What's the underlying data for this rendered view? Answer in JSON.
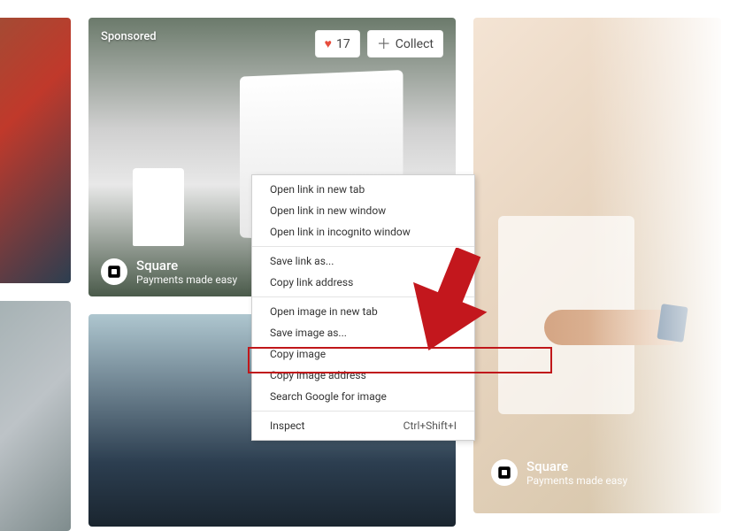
{
  "cards": {
    "sponsored_label": "Sponsored",
    "like_count": "17",
    "collect_label": "Collect",
    "brand_name": "Square",
    "brand_tagline": "Payments made easy"
  },
  "context_menu": {
    "items": [
      "Open link in new tab",
      "Open link in new window",
      "Open link in incognito window",
      "Save link as...",
      "Copy link address",
      "Open image in new tab",
      "Save image as...",
      "Copy image",
      "Copy image address",
      "Search Google for image",
      "Inspect"
    ],
    "inspect_shortcut": "Ctrl+Shift+I",
    "highlighted_item": "Copy image address"
  }
}
